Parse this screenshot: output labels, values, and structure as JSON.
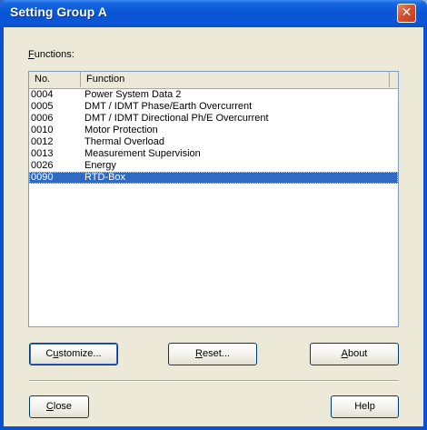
{
  "dialog": {
    "title": "Setting Group A",
    "close_glyph": "✕"
  },
  "functions": {
    "label": "Functions:",
    "columns": [
      "No.",
      "Function"
    ],
    "rows": [
      {
        "no": "0004",
        "name": "Power System Data 2"
      },
      {
        "no": "0005",
        "name": "DMT / IDMT Phase/Earth Overcurrent"
      },
      {
        "no": "0006",
        "name": "DMT / IDMT Directional Ph/E Overcurrent"
      },
      {
        "no": "0010",
        "name": "Motor Protection"
      },
      {
        "no": "0012",
        "name": "Thermal Overload"
      },
      {
        "no": "0013",
        "name": "Measurement Supervision"
      },
      {
        "no": "0026",
        "name": "Energy"
      },
      {
        "no": "0090",
        "name": "RTD-Box"
      }
    ],
    "selected_index": 7
  },
  "buttons": {
    "customize": "Customize...",
    "reset": "Reset...",
    "about": "About",
    "close": "Close",
    "help": "Help"
  },
  "icons": {
    "close": "close-icon"
  },
  "colors": {
    "titlebar": "#0a55d6",
    "selection": "#316ac5",
    "dialog_bg": "#ece9d8"
  }
}
